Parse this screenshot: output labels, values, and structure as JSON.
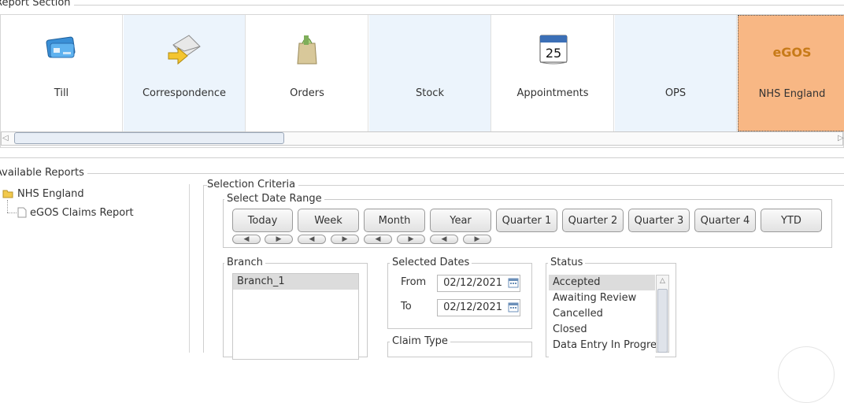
{
  "report_section": {
    "title": "Report Section",
    "tiles": [
      {
        "label": "Till",
        "icon": "credit-card-icon"
      },
      {
        "label": "Correspondence",
        "icon": "envelope-arrow-icon"
      },
      {
        "label": "Orders",
        "icon": "orders-bag-icon"
      },
      {
        "label": "Stock",
        "icon": ""
      },
      {
        "label": "Appointments",
        "icon": "calendar-icon"
      },
      {
        "label": "OPS",
        "icon": ""
      },
      {
        "label": "NHS England",
        "icon": "egos-logo-icon",
        "logo_text": "eGOS"
      }
    ]
  },
  "available_reports": {
    "title": "Available Reports",
    "tree": {
      "root": "NHS England",
      "child": "eGOS Claims Report"
    }
  },
  "selection_criteria": {
    "title": "Selection Criteria",
    "date_range": {
      "title": "Select Date Range",
      "buttons": [
        "Today",
        "Week",
        "Month",
        "Year",
        "Quarter 1",
        "Quarter 2",
        "Quarter 3",
        "Quarter 4",
        "YTD"
      ]
    },
    "branch": {
      "title": "Branch",
      "items": [
        "Branch_1"
      ]
    },
    "selected_dates": {
      "title": "Selected Dates",
      "from_label": "From",
      "from_value": "02/12/2021",
      "to_label": "To",
      "to_value": "02/12/2021"
    },
    "claim_type": {
      "title": "Claim Type"
    },
    "status": {
      "title": "Status",
      "items": [
        "Accepted",
        "Awaiting Review",
        "Cancelled",
        "Closed",
        "Data Entry In Progress"
      ],
      "selected": "Accepted"
    }
  },
  "colors": {
    "active_tile": "#f8b784",
    "alt_tile": "#ecf4fc"
  }
}
